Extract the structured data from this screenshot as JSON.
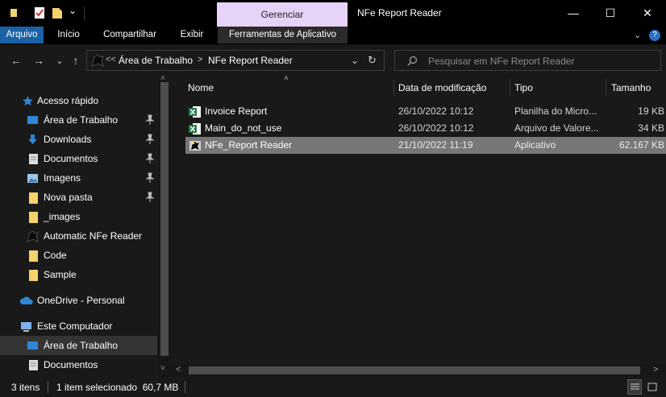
{
  "titlebar": {
    "context_tab": "Gerenciar",
    "window_title": "NFe Report Reader",
    "minimize": "—",
    "maximize": "☐",
    "close": "✕"
  },
  "ribbon": {
    "tabs": [
      "Arquivo",
      "Início",
      "Compartilhar",
      "Exibir",
      "Ferramentas de Aplicativo"
    ],
    "expand_glyph": "⌄",
    "help_glyph": "?"
  },
  "navigation": {
    "back_glyph": "←",
    "forward_glyph": "→",
    "recent_glyph": "⌄",
    "up_glyph": "↑",
    "overflow": "<<",
    "breadcrumb": [
      "Área de Trabalho",
      "NFe Report Reader"
    ],
    "breadcrumb_separator": ">",
    "address_dropdown": "⌄",
    "refresh_glyph": "↻",
    "search_placeholder": "Pesquisar em NFe Report Reader"
  },
  "sidebar": {
    "items": [
      {
        "label": "Acesso rápido",
        "icon": "star-icon",
        "pinned": false
      },
      {
        "label": "Área de Trabalho",
        "icon": "desktop-icon",
        "pinned": true
      },
      {
        "label": "Downloads",
        "icon": "download-icon",
        "pinned": true
      },
      {
        "label": "Documentos",
        "icon": "document-icon",
        "pinned": true
      },
      {
        "label": "Imagens",
        "icon": "image-icon",
        "pinned": true
      },
      {
        "label": "Nova pasta",
        "icon": "folder-icon",
        "pinned": true
      },
      {
        "label": "_images",
        "icon": "folder-icon",
        "pinned": false
      },
      {
        "label": "Automatic NFe Reader",
        "icon": "app-logo-icon",
        "pinned": false
      },
      {
        "label": "Code",
        "icon": "folder-icon",
        "pinned": false
      },
      {
        "label": "Sample",
        "icon": "folder-icon",
        "pinned": false
      },
      {
        "label": "OneDrive - Personal",
        "icon": "cloud-icon",
        "pinned": false
      },
      {
        "label": "Este Computador",
        "icon": "computer-icon",
        "pinned": false
      },
      {
        "label": "Área de Trabalho",
        "icon": "desktop-icon",
        "pinned": false
      },
      {
        "label": "Documentos",
        "icon": "document-icon",
        "pinned": false
      }
    ],
    "scroll_up": "˄",
    "scroll_down": "˅"
  },
  "file_list": {
    "sort_glyph": "˄",
    "columns": [
      "Nome",
      "Data de modificação",
      "Tipo",
      "Tamanho"
    ],
    "rows": [
      {
        "name": "Invoice Report",
        "modified": "26/10/2022 10:12",
        "type": "Planilha do Micro...",
        "size": "19 KB",
        "icon": "excel-icon"
      },
      {
        "name": "Main_do_not_use",
        "modified": "26/10/2022 10:12",
        "type": "Arquivo de Valore...",
        "size": "34 KB",
        "icon": "excel-csv-icon"
      },
      {
        "name": "NFe_Report Reader",
        "modified": "21/10/2022 11:19",
        "type": "Aplicativo",
        "size": "62.167 KB",
        "icon": "application-icon"
      }
    ],
    "scroll_left": "<",
    "scroll_right": ">"
  },
  "status": {
    "item_count": "3 itens",
    "selection": "1 item selecionado  60,7 MB"
  },
  "colors": {
    "background": "#191919",
    "file_tab": "#1a62a6",
    "context_tab": "#e7d3f7",
    "selection": "#777777",
    "folder": "#f5d36b",
    "excel": "#1f7a45"
  }
}
